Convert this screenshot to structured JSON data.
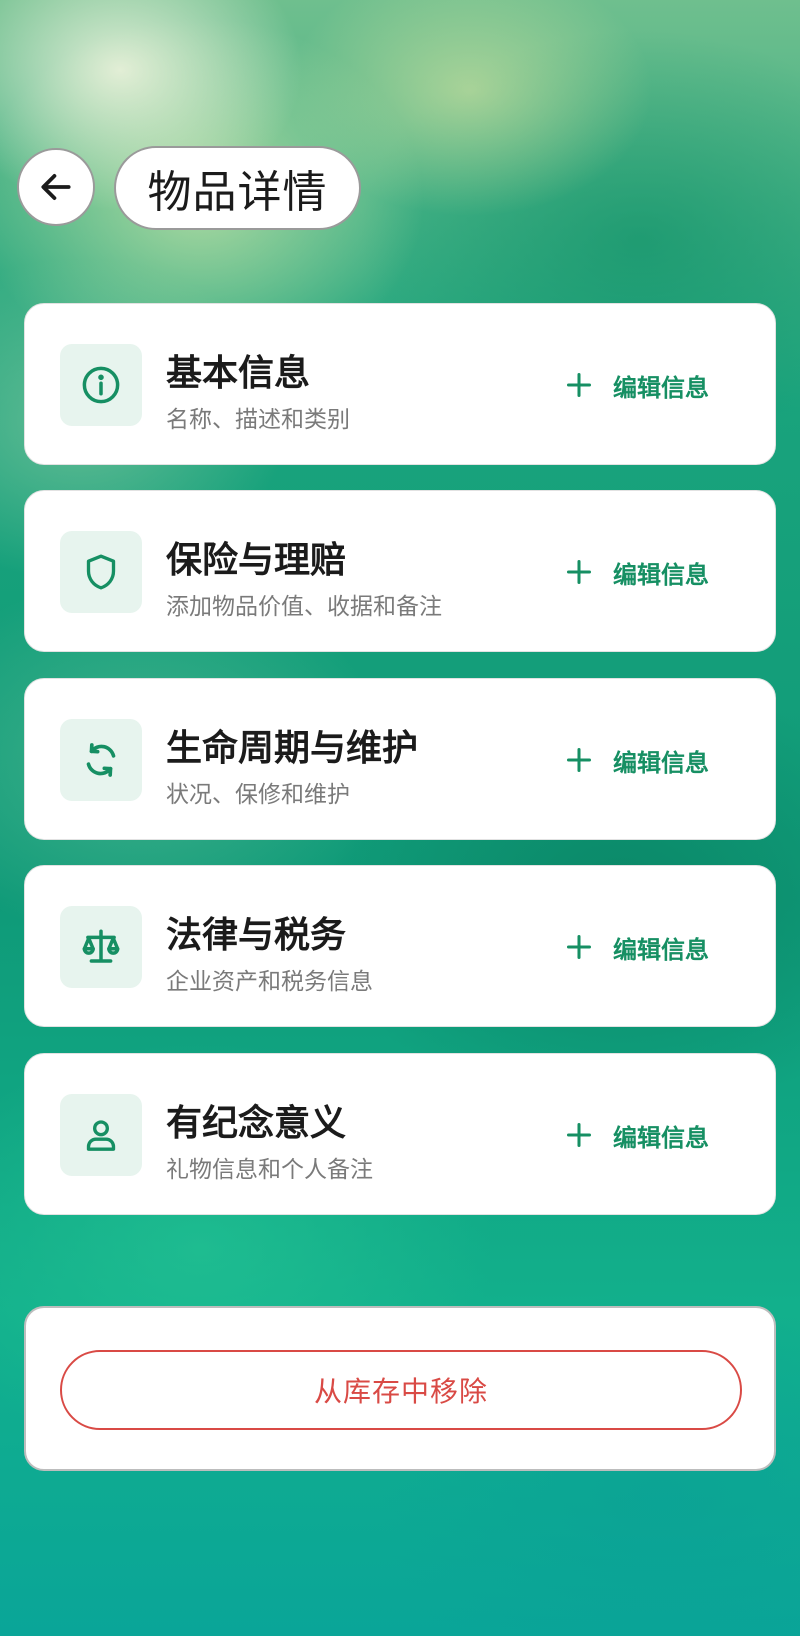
{
  "header": {
    "back_icon": "arrow-left-icon",
    "title": "物品详情"
  },
  "accent_color": "#168f63",
  "danger_color": "#d94a45",
  "sections": [
    {
      "title": "基本信息",
      "subtitle": "名称、描述和类别",
      "icon": "info-circle-icon",
      "action_label": "编辑信息"
    },
    {
      "title": "保险与理赔",
      "subtitle": "添加物品价值、收据和备注",
      "icon": "shield-icon",
      "action_label": "编辑信息"
    },
    {
      "title": "生命周期与维护",
      "subtitle": "状况、保修和维护",
      "icon": "refresh-cycle-icon",
      "action_label": "编辑信息"
    },
    {
      "title": "法律与税务",
      "subtitle": "企业资产和税务信息",
      "icon": "scale-balance-icon",
      "action_label": "编辑信息"
    },
    {
      "title": "有纪念意义",
      "subtitle": "礼物信息和个人备注",
      "icon": "person-icon",
      "action_label": "编辑信息"
    }
  ],
  "remove": {
    "label": "从库存中移除"
  }
}
